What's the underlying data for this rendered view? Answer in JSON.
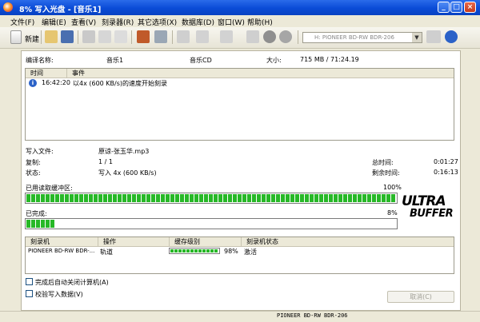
{
  "window": {
    "title": "8% 写入光盘 - [音乐1]",
    "buttons": {
      "minimize": "_",
      "maximize": "□",
      "close": "×"
    }
  },
  "menu": [
    "文件(F)",
    "编辑(E)",
    "查看(V)",
    "刻录器(R)",
    "其它选项(X)",
    "数据库(D)",
    "窗口(W)",
    "帮助(H)"
  ],
  "toolbar": {
    "new_label": "新建",
    "drive": "H: PIONEER BD-RW   BDR-206",
    "drive_arrow": "▼"
  },
  "compilation": {
    "name_label": "编译名称:",
    "name_value": "音乐1",
    "type_value": "音乐CD",
    "size_label": "大小:",
    "size_value": "715 MB  /  71:24.19"
  },
  "log": {
    "columns": [
      "时间",
      "事件"
    ],
    "rows": [
      {
        "time": "16:42:20",
        "event": "以4x (600 KB/s)的速度开始刻录"
      }
    ]
  },
  "status": {
    "writing_file_label": "写入文件:",
    "writing_file_value": "原谅-张玉华.mp3",
    "copy_label": "复制:",
    "copy_value": "1 / 1",
    "state_label": "状态:",
    "state_value": "写入 4x (600 KB/s)",
    "total_time_label": "总时间:",
    "total_time_value": "0:01:27",
    "remaining_label": "剩余时间:",
    "remaining_value": "0:16:13"
  },
  "buffer": {
    "label": "已用读取缓冲区:",
    "percent_text": "100%",
    "value": 100
  },
  "completed": {
    "label": "已完成:",
    "percent_text": "8%",
    "value": 8
  },
  "logo": {
    "line1": "ULTRA",
    "line2": "BUFFER"
  },
  "recorders": {
    "columns": [
      "刻录机",
      "操作",
      "缓存级别",
      "刻录机状态"
    ],
    "rows": [
      {
        "recorder": "PIONEER BD-RW  BDR-...",
        "action": "轨道",
        "buffer_text": "98%",
        "buffer_value": 98,
        "state": "激活"
      }
    ]
  },
  "options": {
    "shutdown_label": "完成后自动关闭计算机(A)",
    "verify_label": "校验写入数据(V)"
  },
  "cancel_label": "取消(C)",
  "statusbar": {
    "drive": "PIONEER  BD-RW  BDR-206"
  },
  "colors": {
    "title_bar": "#0a4bd6",
    "progress": "#27b827",
    "window_bg": "#ece9d8"
  }
}
